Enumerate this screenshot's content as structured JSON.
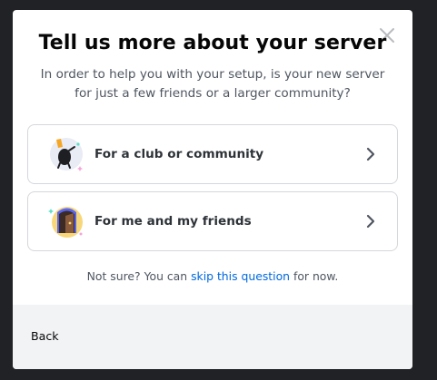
{
  "modal": {
    "title": "Tell us more about your server",
    "subtitle": "In order to help you with your setup, is your new server for just a few friends or a larger community?",
    "close_icon": "close-icon",
    "options": [
      {
        "label": "For a club or community",
        "icon": "club-community-icon",
        "chevron": "chevron-right-icon"
      },
      {
        "label": "For me and my friends",
        "icon": "friends-icon",
        "chevron": "chevron-right-icon"
      }
    ],
    "note": {
      "prefix": "Not sure? You can ",
      "link": "skip this question",
      "suffix": " for now."
    },
    "footer": {
      "back_label": "Back"
    }
  },
  "colors": {
    "backdrop": "#202225",
    "modal_bg": "#ffffff",
    "footer_bg": "#f2f3f5",
    "link": "#0068e0",
    "title": "#060607",
    "muted_text": "#4f5660"
  }
}
